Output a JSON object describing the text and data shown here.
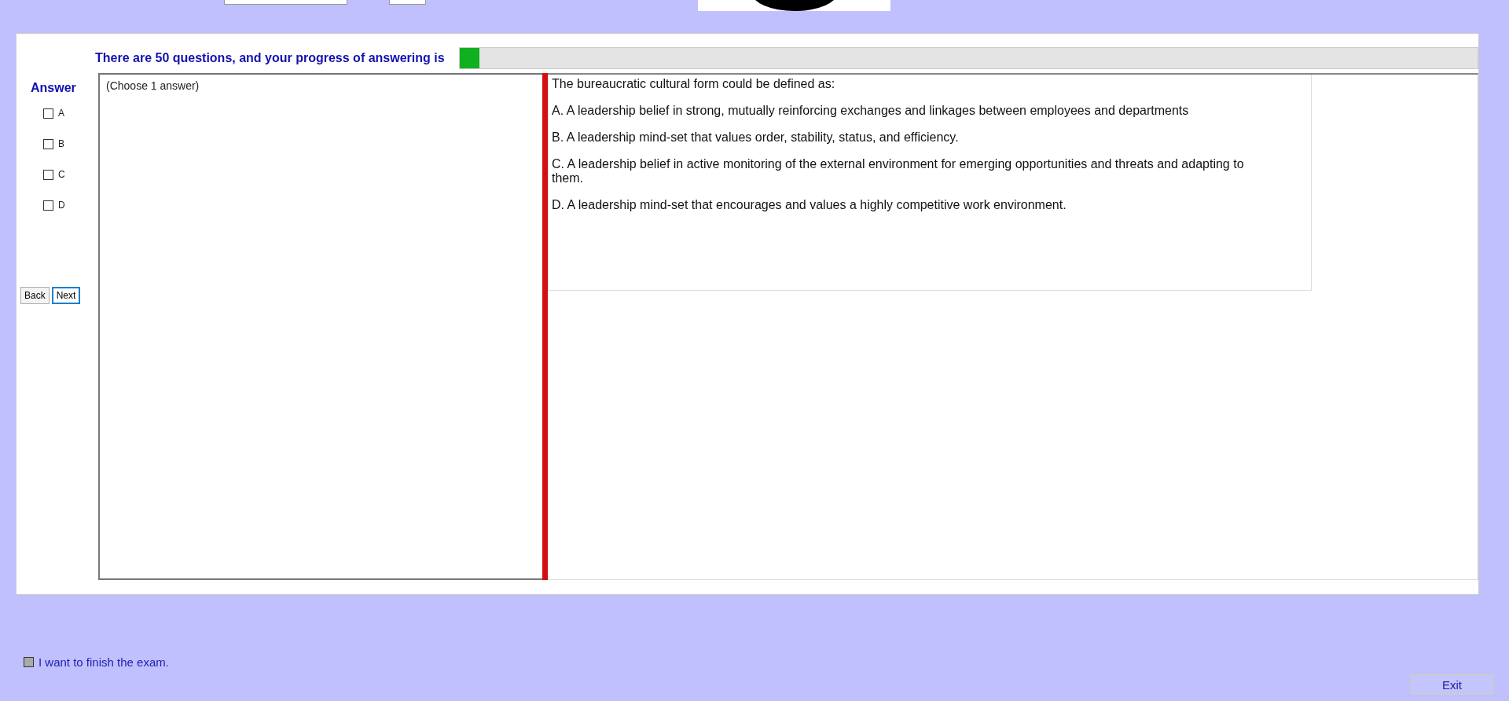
{
  "progress": {
    "label": "There are 50 questions, and your progress of answering is",
    "level": 0.02
  },
  "answer": {
    "title": "Answer",
    "options": [
      {
        "label": "A",
        "checked": false
      },
      {
        "label": "B",
        "checked": false
      },
      {
        "label": "C",
        "checked": false
      },
      {
        "label": "D",
        "checked": false
      }
    ]
  },
  "navigation": [
    "Back",
    "Next"
  ],
  "answer_box": {
    "hint": "(Choose 1 answer)"
  },
  "question": {
    "stem": "The bureaucratic cultural form could be defined as:",
    "choices": [
      "A.  A leadership belief in strong, mutually reinforcing exchanges and linkages between employees and departments",
      "B.  A leadership mind-set that values order, stability, status, and efficiency.",
      "C.  A leadership belief in active monitoring of the external environment for emerging opportunities and threats and adapting to them.",
      "D.  A leadership mind-set that encourages and values a highly competitive work environment."
    ]
  },
  "finish": {
    "label": "I want to finish the exam.",
    "checked": false
  },
  "exit_button": "Exit"
}
